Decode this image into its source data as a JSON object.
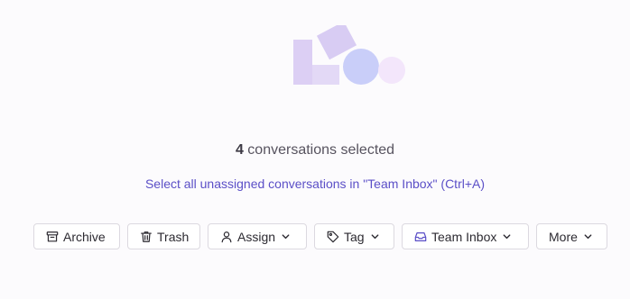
{
  "selection": {
    "count": "4",
    "label": "conversations selected"
  },
  "select_all_link": "Select all unassigned conversations in \"Team Inbox\" (Ctrl+A)",
  "toolbar": {
    "archive_label": "Archive",
    "trash_label": "Trash",
    "assign_label": "Assign",
    "tag_label": "Tag",
    "inbox_label": "Team Inbox",
    "more_label": "More"
  },
  "icons": {
    "archive": "archive-icon",
    "trash": "trash-icon",
    "assign": "user-icon",
    "tag": "tag-icon",
    "inbox": "inbox-icon",
    "dropdown": "chevron-down-icon"
  },
  "colors": {
    "link": "#5b4fc7",
    "illustration_square": "#dccff4",
    "illustration_circle": "#c9cef9",
    "illustration_small_circle": "#f3e6fb"
  }
}
